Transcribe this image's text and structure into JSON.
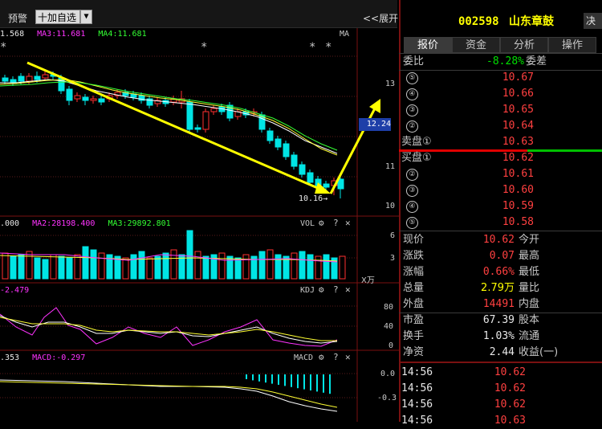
{
  "toolbar": {
    "alert_label": "预警",
    "add_label": "十加自选",
    "expand_label": "<<展开"
  },
  "main_chart": {
    "ma_legend": [
      {
        "text": "1.568",
        "color": "#e8e8e8"
      },
      {
        "text": "MA3:11.681",
        "color": "#ff33ff"
      },
      {
        "text": "MA4:11.681",
        "color": "#33ff33"
      }
    ],
    "ma_tag": "MA",
    "stars": [
      "*",
      "*",
      "*",
      "*"
    ],
    "price_axis": [
      "13",
      "12.24",
      "11",
      "10"
    ],
    "current_price_label": "12.24",
    "low_label": "10.16→"
  },
  "volume_chart": {
    "legend": [
      {
        "text": ".000",
        "color": "#e8e8e8"
      },
      {
        "text": "MA2:28198.400",
        "color": "#ff33ff"
      },
      {
        "text": "MA3:29892.801",
        "color": "#33ff33"
      }
    ],
    "tag": "VOL",
    "axis": [
      "6",
      "3"
    ],
    "unit": "X万"
  },
  "kdj_chart": {
    "legend": [
      {
        "text": "-2.479",
        "color": "#ff33ff"
      }
    ],
    "tag": "KDJ",
    "axis": [
      "80",
      "40",
      "0"
    ]
  },
  "macd_chart": {
    "legend": [
      {
        "text": ".353",
        "color": "#e8e8e8"
      },
      {
        "text": "MACD:-0.297",
        "color": "#ff33ff"
      }
    ],
    "tag": "MACD",
    "axis": [
      "0.0",
      "-0.3"
    ]
  },
  "stock": {
    "code": "002598",
    "name": "山东章鼓",
    "decision_label": "决"
  },
  "tabs": [
    "报价",
    "资金",
    "分析",
    "操作"
  ],
  "weibi": {
    "label": "委比",
    "value": "-8.28%",
    "diff_label": "委差"
  },
  "sell_orders": [
    {
      "label": "⑤",
      "price": "10.67"
    },
    {
      "label": "④",
      "price": "10.66"
    },
    {
      "label": "③",
      "price": "10.65"
    },
    {
      "label": "②",
      "price": "10.64"
    },
    {
      "label": "卖盘①",
      "price": "10.63"
    }
  ],
  "buy_orders": [
    {
      "label": "买盘①",
      "price": "10.62"
    },
    {
      "label": "②",
      "price": "10.61"
    },
    {
      "label": "③",
      "price": "10.60"
    },
    {
      "label": "④",
      "price": "10.59"
    },
    {
      "label": "⑤",
      "price": "10.58"
    }
  ],
  "quote_stats": [
    {
      "label": "现价",
      "value": "10.62",
      "color": "#ff4040",
      "label2": "今开"
    },
    {
      "label": "涨跌",
      "value": "0.07",
      "color": "#ff4040",
      "label2": "最高"
    },
    {
      "label": "涨幅",
      "value": "0.66%",
      "color": "#ff4040",
      "label2": "最低"
    },
    {
      "label": "总量",
      "value": "2.79万",
      "color": "#ffff00",
      "label2": "量比"
    },
    {
      "label": "外盘",
      "value": "14491",
      "color": "#ff4040",
      "label2": "内盘"
    }
  ],
  "fundamentals": [
    {
      "label": "市盈",
      "value": "67.39",
      "label2": "股本"
    },
    {
      "label": "换手",
      "value": "1.03%",
      "label2": "流通"
    },
    {
      "label": "净资",
      "value": "2.44",
      "label2": "收益(一)"
    }
  ],
  "ticks": [
    {
      "time": "14:56",
      "price": "10.62"
    },
    {
      "time": "14:56",
      "price": "10.62"
    },
    {
      "time": "14:56",
      "price": "10.62"
    },
    {
      "time": "14:56",
      "price": "10.63"
    }
  ]
}
